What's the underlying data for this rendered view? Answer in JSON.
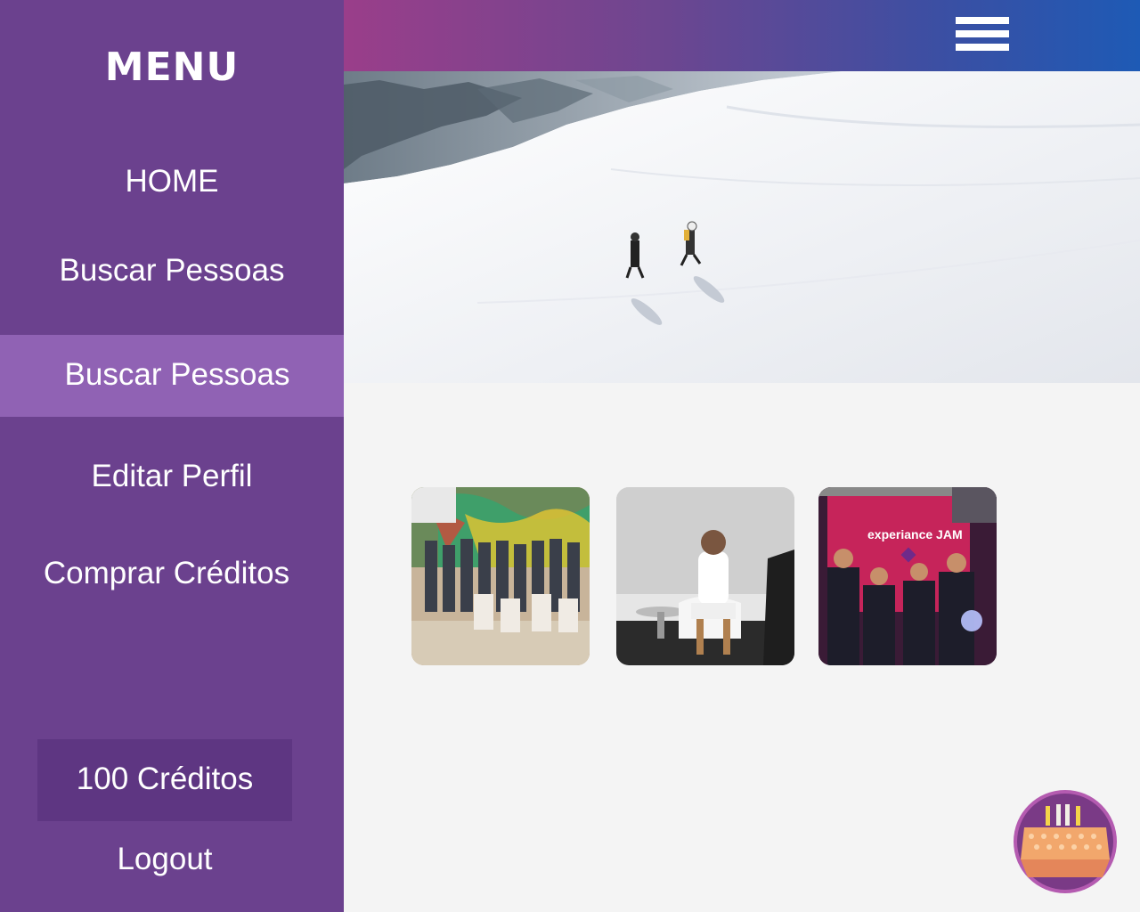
{
  "sidebar": {
    "title": "MENU",
    "items": [
      {
        "label": "HOME"
      },
      {
        "label": "Buscar Pessoas"
      },
      {
        "label": "Buscar Pessoas"
      },
      {
        "label": "Editar Perfil"
      },
      {
        "label": "Comprar Créditos"
      }
    ],
    "credits": "100 Créditos",
    "logout": "Logout"
  },
  "header": {
    "menu_icon": "hamburger-menu-icon"
  },
  "hero": {
    "image": "snow-mountain-skiers-photo"
  },
  "gallery": {
    "images": [
      {
        "name": "group-photo"
      },
      {
        "name": "speaker-photo"
      },
      {
        "name": "experience-jam-photo",
        "sign_text": "experiance JAM"
      }
    ]
  },
  "badge": {
    "icon": "celebration-table-icon"
  },
  "colors": {
    "sidebar": "#6b418e",
    "sidebar_active": "#9062b4",
    "credits_box": "#5e3682",
    "header_start": "#9a3e8a",
    "header_end": "#1e5ab5",
    "content_bg": "#f4f4f4"
  }
}
